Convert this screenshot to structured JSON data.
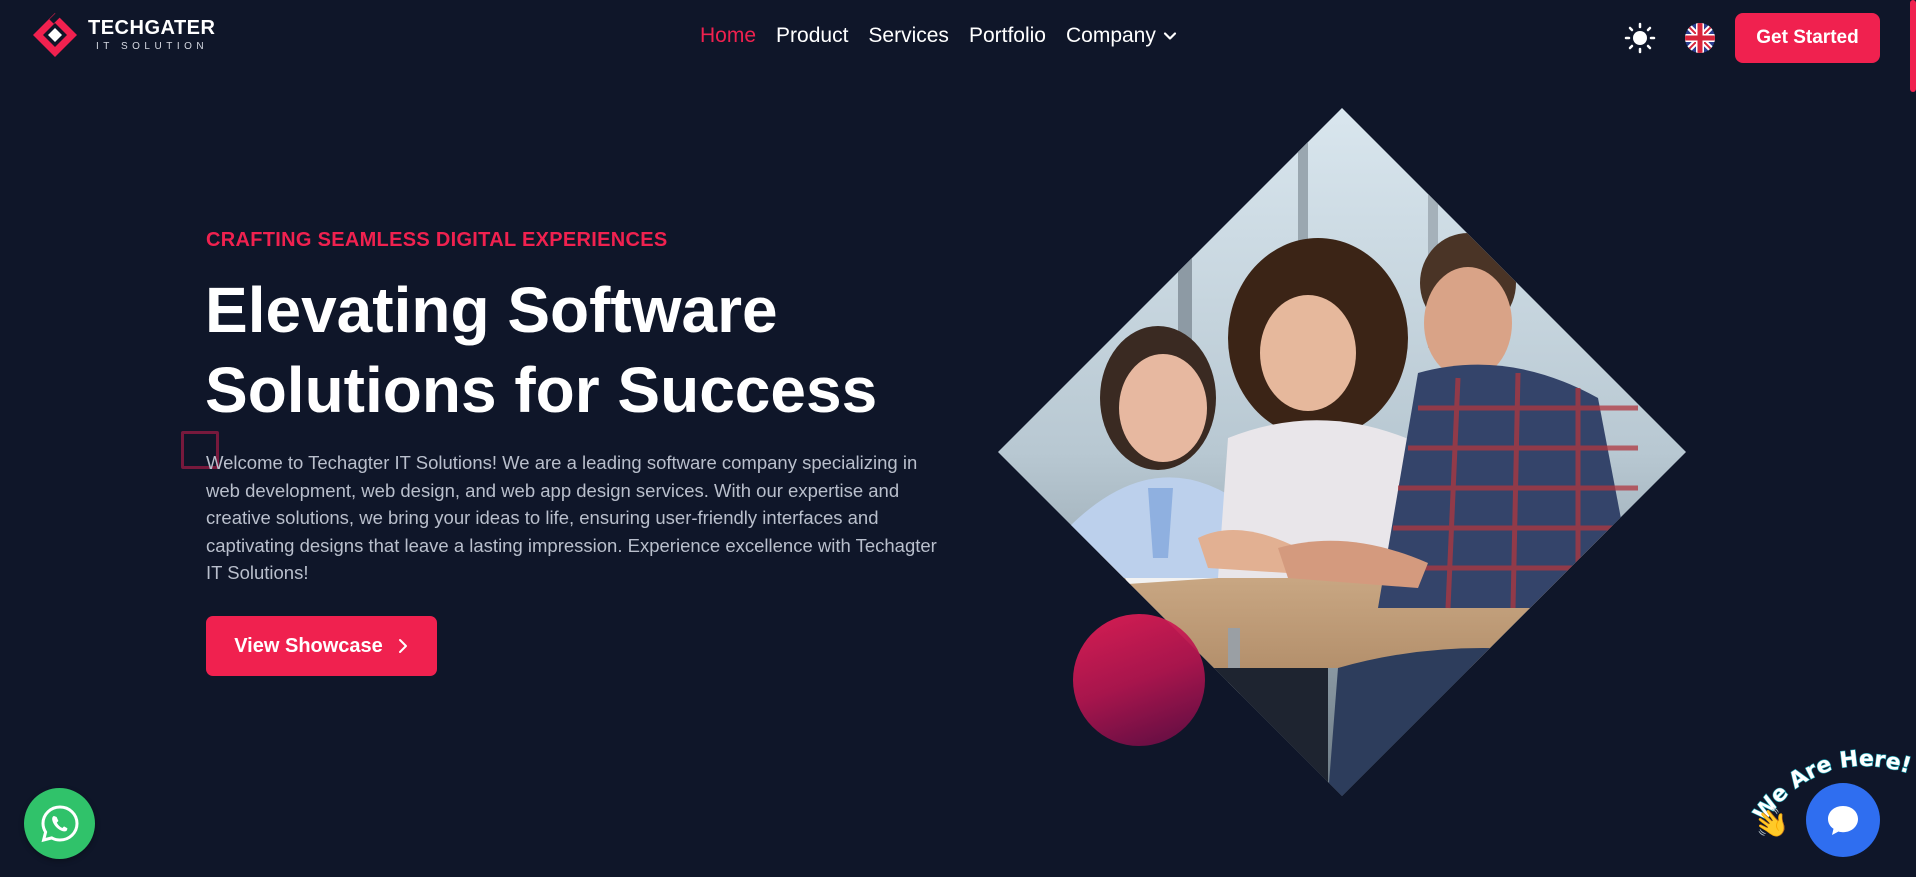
{
  "brand": {
    "name": "TECHGATER",
    "tagline": "IT SOLUTION"
  },
  "nav": {
    "items": [
      {
        "label": "Home",
        "active": true
      },
      {
        "label": "Product",
        "active": false
      },
      {
        "label": "Services",
        "active": false
      },
      {
        "label": "Portfolio",
        "active": false
      },
      {
        "label": "Company",
        "active": false,
        "dropdown": true
      }
    ]
  },
  "header": {
    "theme_icon": "sun-icon",
    "language_icon": "uk-flag-icon",
    "cta_label": "Get Started"
  },
  "hero": {
    "eyebrow": "CRAFTING SEAMLESS DIGITAL EXPERIENCES",
    "title_line1": "Elevating Software",
    "title_line2": "Solutions for Success",
    "description": "Welcome to Techagter IT Solutions! We are a leading software company specializing in web development, web design, and web app design services. With our expertise and creative solutions, we bring your ideas to life, ensuring user-friendly interfaces and captivating designs that leave a lasting impression. Experience excellence with Techagter IT Solutions!",
    "button_label": "View Showcase"
  },
  "widgets": {
    "whatsapp_icon": "whatsapp-icon",
    "chat_icon": "chat-icon",
    "chat_caption": "We Are Here!"
  },
  "colors": {
    "background": "#0f1629",
    "accent": "#f0214f",
    "whatsapp": "#30c26a",
    "chat": "#2f6ef0"
  }
}
